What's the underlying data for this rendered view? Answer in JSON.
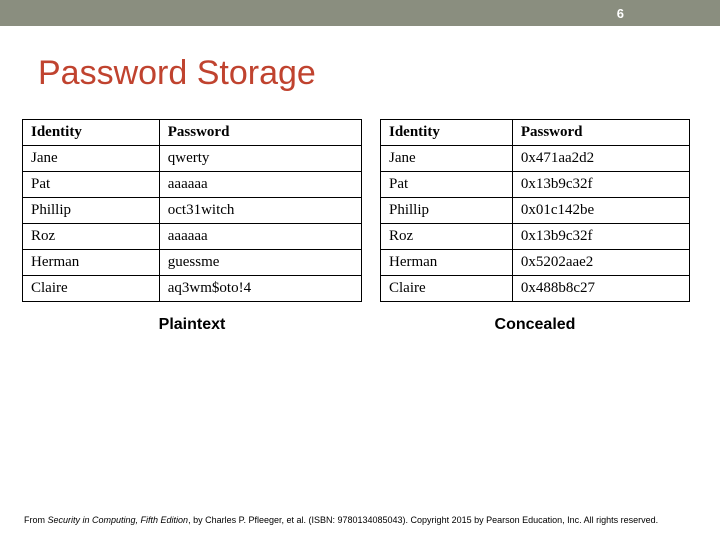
{
  "page_number": "6",
  "title": "Password Storage",
  "tables": {
    "left": {
      "caption": "Plaintext",
      "headers": [
        "Identity",
        "Password"
      ],
      "rows": [
        [
          "Jane",
          "qwerty"
        ],
        [
          "Pat",
          "aaaaaa"
        ],
        [
          "Phillip",
          "oct31witch"
        ],
        [
          "Roz",
          "aaaaaa"
        ],
        [
          "Herman",
          "guessme"
        ],
        [
          "Claire",
          "aq3wm$oto!4"
        ]
      ]
    },
    "right": {
      "caption": "Concealed",
      "headers": [
        "Identity",
        "Password"
      ],
      "rows": [
        [
          "Jane",
          "0x471aa2d2"
        ],
        [
          "Pat",
          "0x13b9c32f"
        ],
        [
          "Phillip",
          "0x01c142be"
        ],
        [
          "Roz",
          "0x13b9c32f"
        ],
        [
          "Herman",
          "0x5202aae2"
        ],
        [
          "Claire",
          "0x488b8c27"
        ]
      ]
    }
  },
  "footer": {
    "prefix": "From ",
    "italic": "Security in Computing, Fifth Edition",
    "rest": ", by Charles P. Pfleeger, et al. (ISBN: 9780134085043). Copyright 2015 by Pearson Education, Inc. All rights reserved."
  }
}
